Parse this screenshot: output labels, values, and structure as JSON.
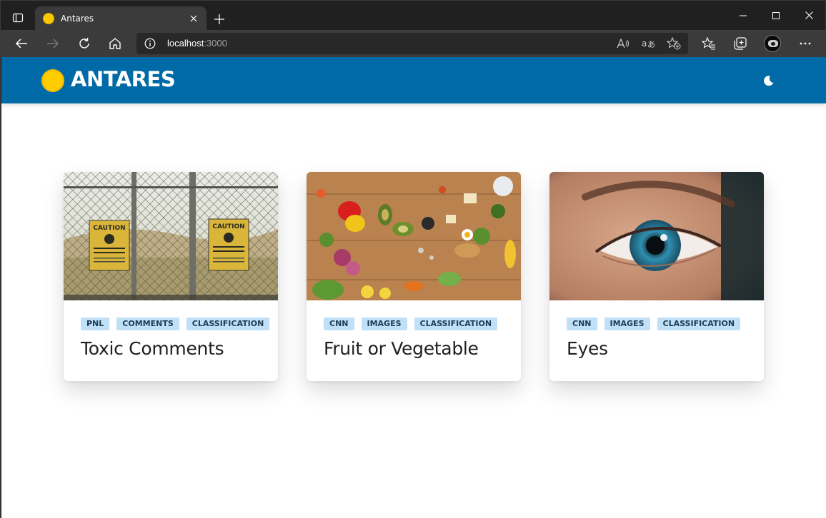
{
  "browser": {
    "tab": {
      "title": "Antares",
      "favicon_color": "#fcc800"
    },
    "address": {
      "host": "localhost",
      "port": ":3000"
    },
    "icons": {
      "tab_actions": "tab-actions-icon",
      "close_tab": "close-icon",
      "new_tab": "plus-icon",
      "back": "back-arrow-icon",
      "forward": "forward-arrow-icon",
      "refresh": "refresh-icon",
      "home": "home-icon",
      "site_info": "info-icon",
      "read_aloud": "read-aloud-icon",
      "translate": "translate-icon",
      "add_favorite": "star-plus-icon",
      "favorites": "favorites-icon",
      "collections": "collections-icon",
      "profile": "avatar",
      "more": "more-icon"
    }
  },
  "app": {
    "brand": "ANTARES",
    "header_color": "#006aa6",
    "logo_color": "#ffcc00",
    "theme_toggle_icon": "moon-icon"
  },
  "cards": [
    {
      "title": "Toxic Comments",
      "tags": [
        "PNL",
        "COMMENTS",
        "CLASSIFICATION"
      ],
      "image": "fence-caution-signs-photo"
    },
    {
      "title": "Fruit or Vegetable",
      "tags": [
        "CNN",
        "IMAGES",
        "CLASSIFICATION"
      ],
      "image": "vegetables-table-photo"
    },
    {
      "title": "Eyes",
      "tags": [
        "CNN",
        "IMAGES",
        "CLASSIFICATION"
      ],
      "image": "eye-closeup-photo"
    }
  ],
  "tag_color": "#bfe0f7"
}
